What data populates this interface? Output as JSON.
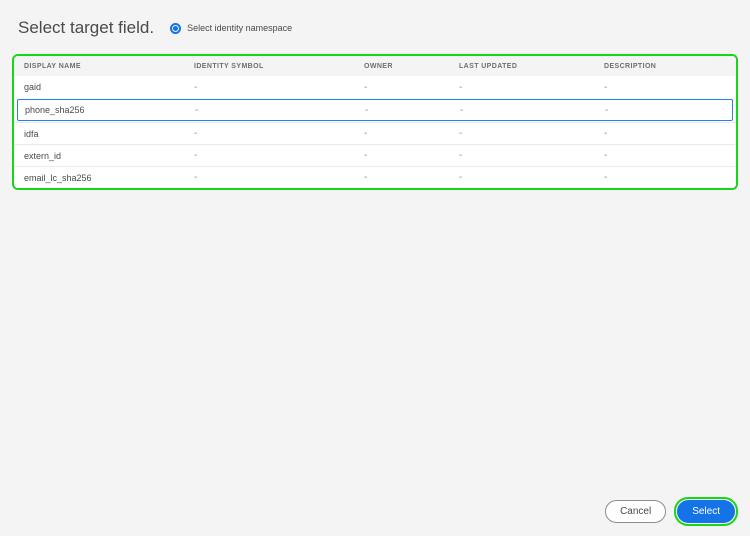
{
  "header": {
    "title": "Select target field.",
    "radio_label": "Select identity namespace"
  },
  "table": {
    "columns": {
      "display": "DISPLAY NAME",
      "symbol": "IDENTITY SYMBOL",
      "owner": "OWNER",
      "updated": "LAST UPDATED",
      "desc": "DESCRIPTION"
    },
    "rows": [
      {
        "display": "gaid",
        "symbol": "-",
        "owner": "-",
        "updated": "-",
        "desc": "-",
        "selected": false
      },
      {
        "display": "phone_sha256",
        "symbol": "-",
        "owner": "-",
        "updated": "-",
        "desc": "-",
        "selected": true
      },
      {
        "display": "idfa",
        "symbol": "-",
        "owner": "-",
        "updated": "-",
        "desc": "-",
        "selected": false
      },
      {
        "display": "extern_id",
        "symbol": "-",
        "owner": "-",
        "updated": "-",
        "desc": "-",
        "selected": false
      },
      {
        "display": "email_lc_sha256",
        "symbol": "-",
        "owner": "-",
        "updated": "-",
        "desc": "-",
        "selected": false
      }
    ]
  },
  "footer": {
    "cancel": "Cancel",
    "select": "Select"
  }
}
